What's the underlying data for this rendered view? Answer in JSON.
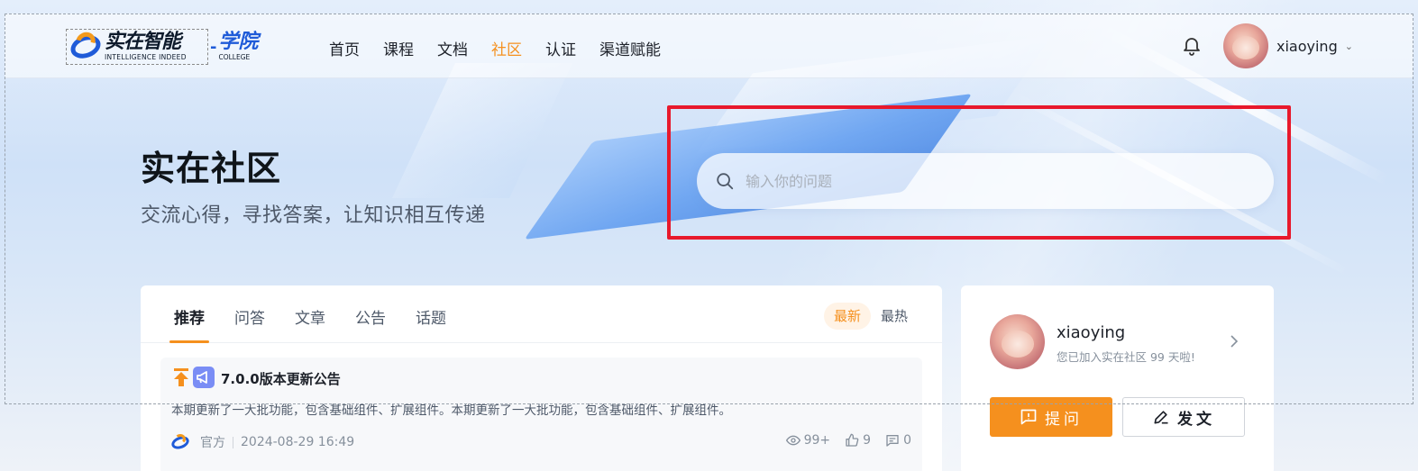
{
  "header": {
    "logo": {
      "brand_cn": "实在智能",
      "brand_en": "INTELLIGENCE INDEED",
      "separator": "-",
      "college_cn": "学院",
      "college_en": "COLLEGE"
    },
    "nav": [
      {
        "label": "首页",
        "active": false
      },
      {
        "label": "课程",
        "active": false
      },
      {
        "label": "文档",
        "active": false
      },
      {
        "label": "社区",
        "active": true
      },
      {
        "label": "认证",
        "active": false
      },
      {
        "label": "渠道赋能",
        "active": false
      }
    ],
    "user": {
      "name": "xiaoying",
      "dropdown_icon": "chevron-down-icon"
    },
    "icons": {
      "notification": "bell-icon"
    }
  },
  "hero": {
    "title": "实在社区",
    "subtitle": "交流心得，寻找答案，让知识相互传递",
    "search": {
      "placeholder": "输入你的问题",
      "value": ""
    }
  },
  "feed": {
    "tabs": [
      {
        "label": "推荐",
        "active": true
      },
      {
        "label": "问答",
        "active": false
      },
      {
        "label": "文章",
        "active": false
      },
      {
        "label": "公告",
        "active": false
      },
      {
        "label": "话题",
        "active": false
      }
    ],
    "sort": {
      "newest": "最新",
      "hottest": "最热",
      "selected": "最新"
    },
    "posts": [
      {
        "title": "7.0.0版本更新公告",
        "body": "本期更新了一大批功能，包含基础组件、扩展组件。本期更新了一大批功能，包含基础组件、扩展组件。",
        "author": "官方",
        "time": "2024-08-29 16:49",
        "views": "99+",
        "likes": "9",
        "comments": "0"
      }
    ]
  },
  "profile_card": {
    "name": "xiaoying",
    "joined_text": "您已加入实在社区 99 天啦!",
    "ask_label": "提问",
    "write_label": "发文"
  },
  "colors": {
    "accent": "#f5901e",
    "highlight_box": "#e8192c",
    "brand_blue": "#1f5bd8"
  }
}
